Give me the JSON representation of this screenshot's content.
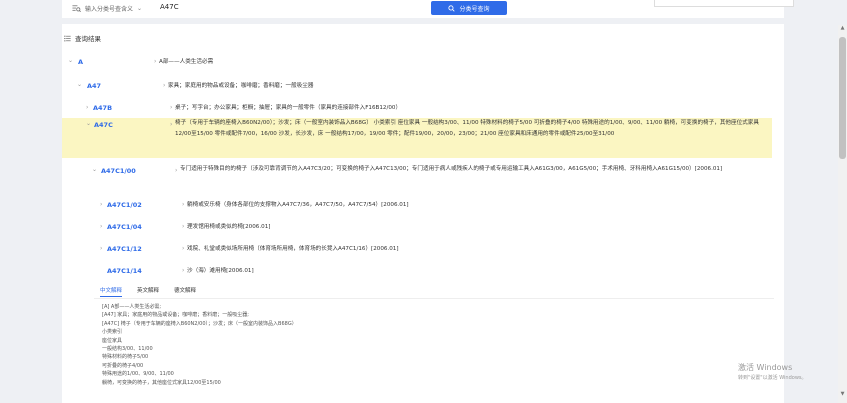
{
  "search": {
    "type_label": "输入分类号查含义",
    "value": "A47C",
    "button_label": "分类号查询"
  },
  "results": {
    "title": "查询结果",
    "rows": [
      {
        "code": "A",
        "desc": "A部——人类生活必需"
      },
      {
        "code": "A47",
        "desc": "家具；家庭用的物品或设备；咖啡磨；香料磨；一般吸尘器"
      },
      {
        "code": "A47B",
        "desc": "桌子；写字台；办公家具；柜橱；抽屉；家具的一般零件（家具的连接部件入F16B12/00）"
      },
      {
        "code": "A47C",
        "desc": "椅子（专用于车辆的座椅入B60N2/00）；沙发；床（一般室内装饰品入B68G） 小类索引 座位家具 一般结构3/00、11/00 特殊材料的椅子5/00 可折叠的椅子4/00 特殊用途的1/00、9/00、11/00 躺椅，可变换的椅子，其他座位式家具12/00至15/00 零件或配件7/00，16/00 沙发，长沙发，床 一般结构17/00，19/00 零件；配件19/00，20/00，23/00；21/00 座位家具和床通用的零件或配件25/00至31/00"
      },
      {
        "code": "A47C1/00",
        "desc": "专门适用于特殊目的的椅子（涉及可靠背调节的入A47C3/20；可变换的椅子入A47C13/00；专门适用于病人或残疾人的椅子或专用运输工具入A61G3/00，A61G5/00；手术用椅、牙科用椅入A61G15/00）[2006.01]"
      },
      {
        "code": "A47C1/02",
        "desc": "躺椅或安乐椅（身体各部位的支撑物入A47C7/36，A47C7/50，A47C7/54）[2006.01]"
      },
      {
        "code": "A47C1/04",
        "desc": "理发馆用椅或类似的椅[2006.01]"
      },
      {
        "code": "A47C1/12",
        "desc": "戏院、礼堂或类似场所用椅（体育场所用椅，体育场的长凳入A47C1/16）[2006.01]"
      },
      {
        "code": "A47C1/14",
        "desc": "沙（海）滩用椅[2006.01]"
      }
    ]
  },
  "detail": {
    "tabs": [
      "中文解释",
      "英文解释",
      "德文解释"
    ],
    "active_tab": 0,
    "lines": [
      "[A] A部——人类生活必需;",
      "[A47] 家具；家庭用的物品或设备；咖啡磨；香料磨；一般吸尘器;",
      "[A47C] 椅子（专用于车辆的座椅入B60N2/00）；沙发；床（一般室内装饰品入B68G）",
      "小类索引",
      "座位家具",
      "一般结构3/00、11/00",
      "特殊材料的椅子5/00",
      "可折叠的椅子4/00",
      "特殊用途的1/00、9/00、11/00",
      "躺椅，可变换的椅子，其他座位式家具12/00至15/00"
    ]
  },
  "watermark": {
    "line1": "激活 Windows",
    "line2": "转到\"设置\"以激活 Windows。"
  },
  "colors": {
    "accent": "#2f6be8",
    "highlight": "#fbf6c2"
  }
}
